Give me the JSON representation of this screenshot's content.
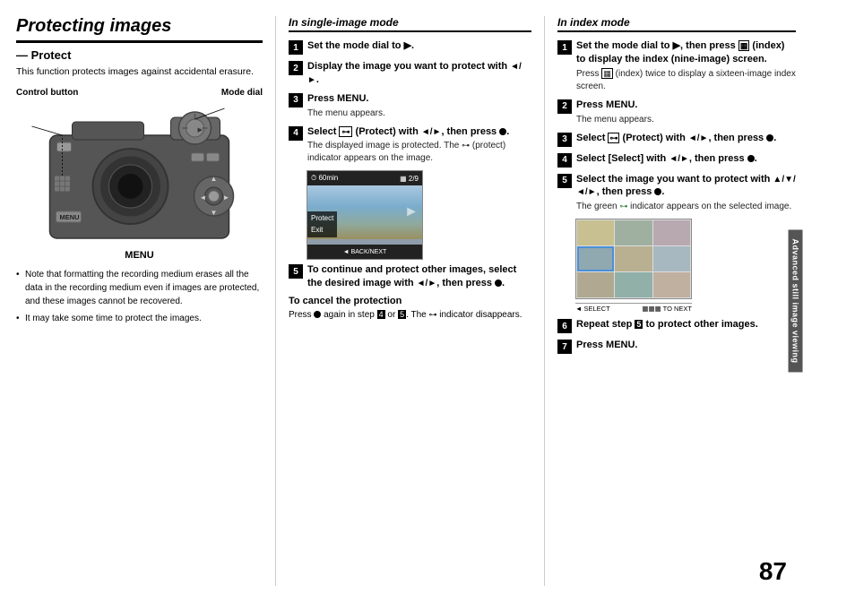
{
  "page": {
    "number": "87",
    "sidebar_label": "Advanced still image viewing"
  },
  "left": {
    "title": "Protecting images",
    "subtitle": "— Protect",
    "description": "This function protects images against accidental erasure.",
    "label_control": "Control button",
    "label_mode_dial": "Mode dial",
    "label_menu": "MENU",
    "bullets": [
      "Note that formatting the recording medium erases all the data in the recording medium even if images are protected, and these images cannot be recovered.",
      "It may take some time to protect the images."
    ]
  },
  "single_image_mode": {
    "header": "In single-image mode",
    "steps": [
      {
        "num": "1",
        "main": "Set the mode dial to ▶.",
        "sub": ""
      },
      {
        "num": "2",
        "main": "Display the image you want to protect with ◄/►.",
        "sub": ""
      },
      {
        "num": "3",
        "main": "Press MENU.",
        "sub": "The menu appears."
      },
      {
        "num": "4",
        "main": "Select ⊶ (Protect) with ◄/►, then press ●.",
        "sub": "The displayed image is protected. The ⊶ (protect) indicator appears on the image."
      },
      {
        "num": "5",
        "main": "To continue and protect other images, select the desired image with ◄/►, then press ●.",
        "sub": ""
      }
    ],
    "cancel_title": "To cancel the protection",
    "cancel_text": "Press ● again in step 4 or 5. The ⊶ indicator disappears.",
    "screen": {
      "top_left": "60min",
      "top_right": "2/9",
      "protect": "Protect",
      "exit": "Exit",
      "back_next": "◄ BACK/NEXT"
    }
  },
  "index_mode": {
    "header": "In index mode",
    "steps": [
      {
        "num": "1",
        "main": "Set the mode dial to ▶, then press ▦ (index) to display the index (nine-image) screen.",
        "sub": "Press ▦ (index) twice to display a sixteen-image index screen."
      },
      {
        "num": "2",
        "main": "Press MENU.",
        "sub": "The menu appears."
      },
      {
        "num": "3",
        "main": "Select ⊶ (Protect) with ◄/►, then press ●.",
        "sub": ""
      },
      {
        "num": "4",
        "main": "Select [Select] with ◄/►, then press ●.",
        "sub": ""
      },
      {
        "num": "5",
        "main": "Select the image you want to protect with ▲/▼/◄/►, then press ●.",
        "sub": "The green ⊶ indicator appears on the selected image."
      },
      {
        "num": "6",
        "main": "Repeat step 5 to protect other images.",
        "sub": ""
      },
      {
        "num": "7",
        "main": "Press MENU.",
        "sub": ""
      }
    ],
    "index_label_select": "◄ SELECT",
    "index_label_next": "▦▦▦ TO NEXT"
  }
}
